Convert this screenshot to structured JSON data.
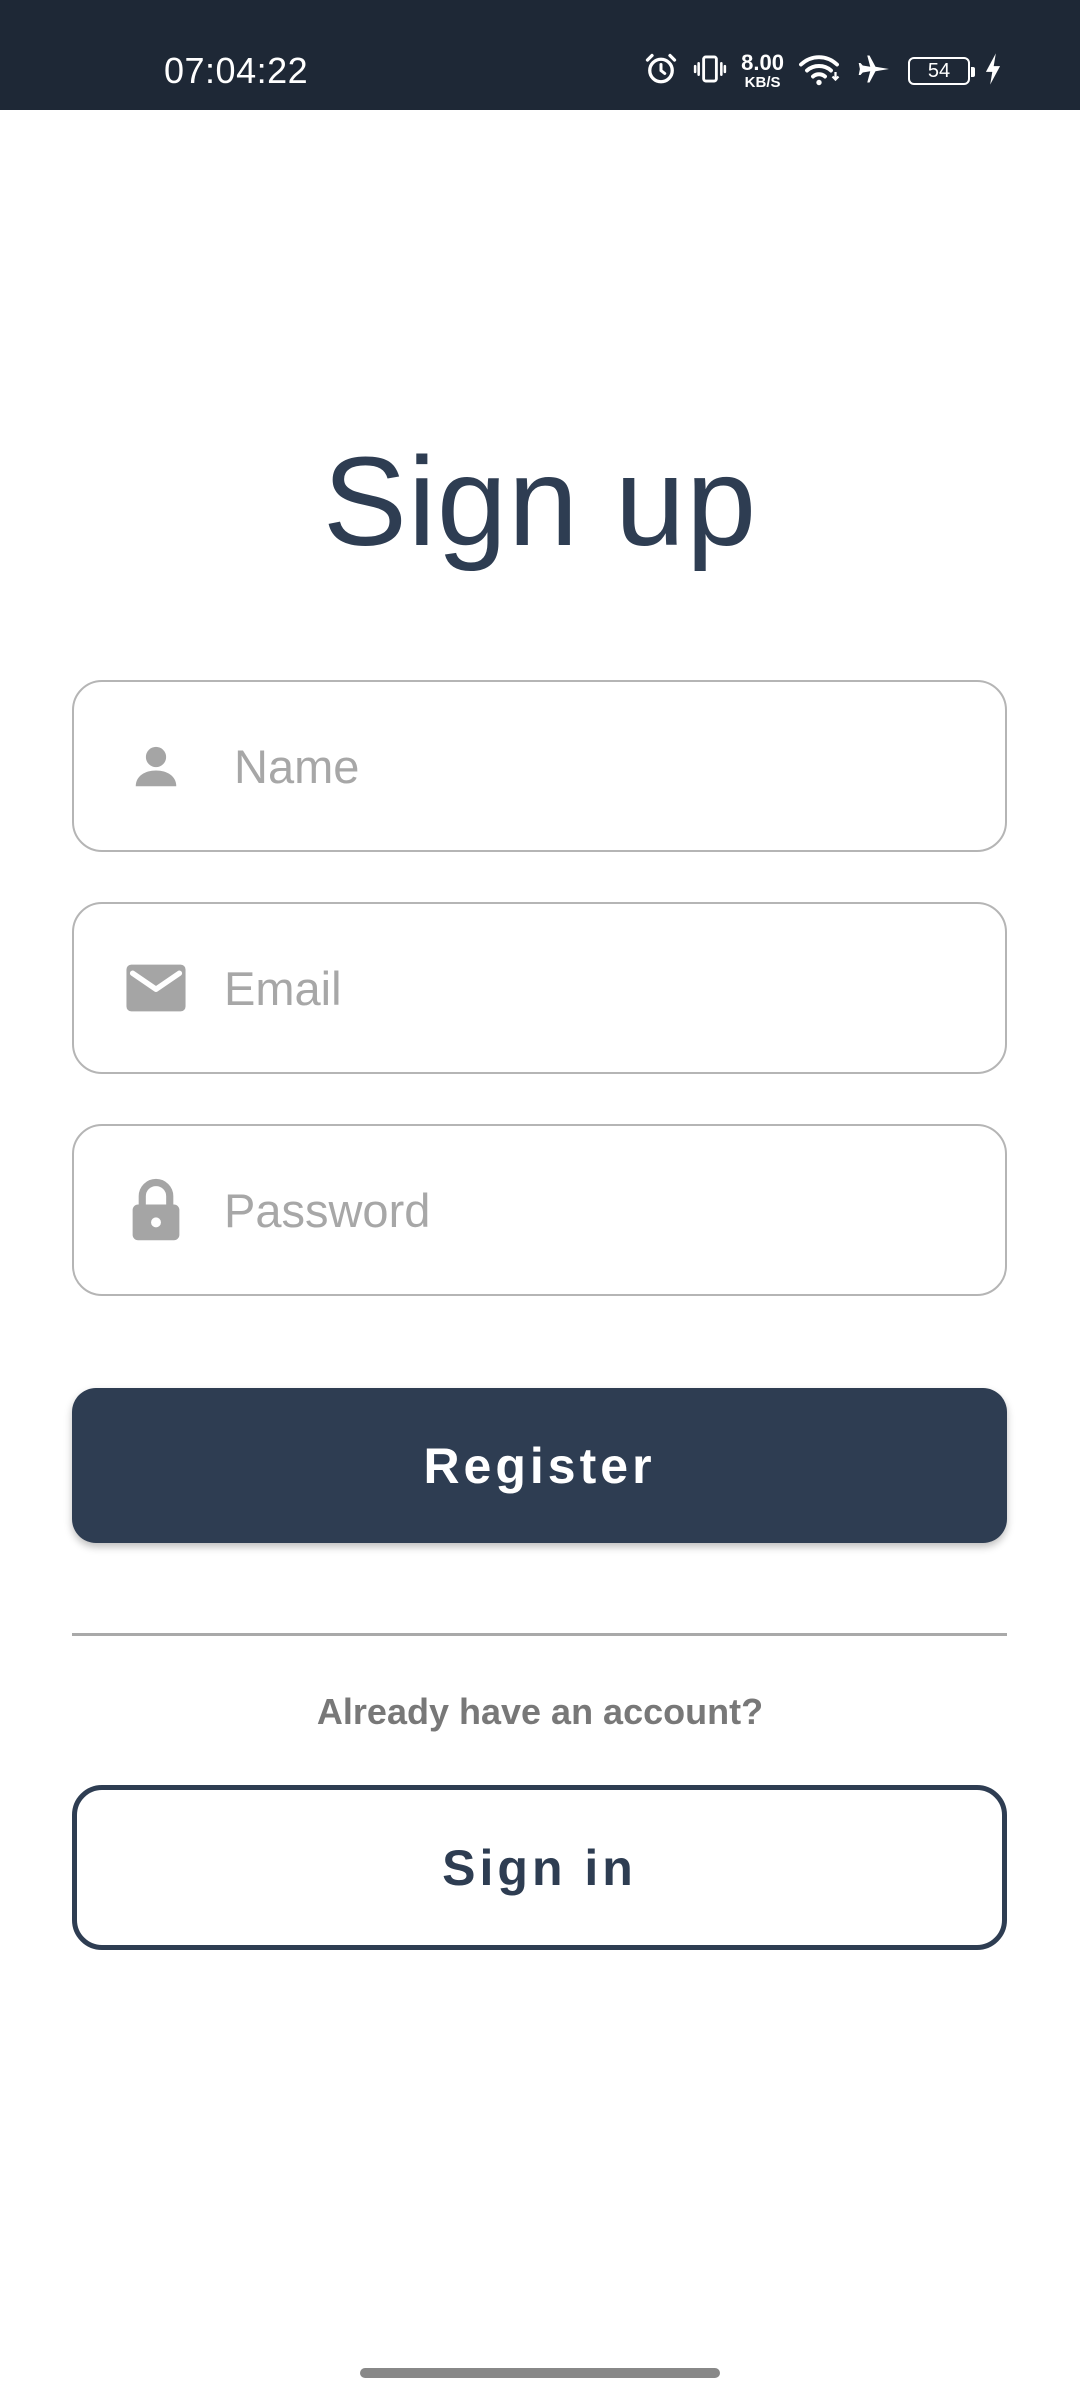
{
  "status_bar": {
    "time": "07:04:22",
    "net_speed_value": "8.00",
    "net_speed_unit": "KB/S",
    "battery_level": "54",
    "icons": [
      "alarm-icon",
      "vibrate-icon",
      "wifi-icon",
      "airplane-icon",
      "battery-icon",
      "charging-icon"
    ]
  },
  "page": {
    "title": "Sign up"
  },
  "form": {
    "name": {
      "placeholder": "Name",
      "value": "",
      "icon": "person-icon"
    },
    "email": {
      "placeholder": "Email",
      "value": "",
      "icon": "mail-icon"
    },
    "password": {
      "placeholder": "Password",
      "value": "",
      "icon": "lock-icon"
    }
  },
  "actions": {
    "register_label": "Register",
    "account_prompt": "Already have an account?",
    "signin_label": "Sign in"
  },
  "colors": {
    "primary": "#2e3d52",
    "status_bar_bg": "#1e2836",
    "field_border": "#b5b5b5",
    "placeholder": "#a7a7a7",
    "icon_gray": "#a5a5a5"
  }
}
